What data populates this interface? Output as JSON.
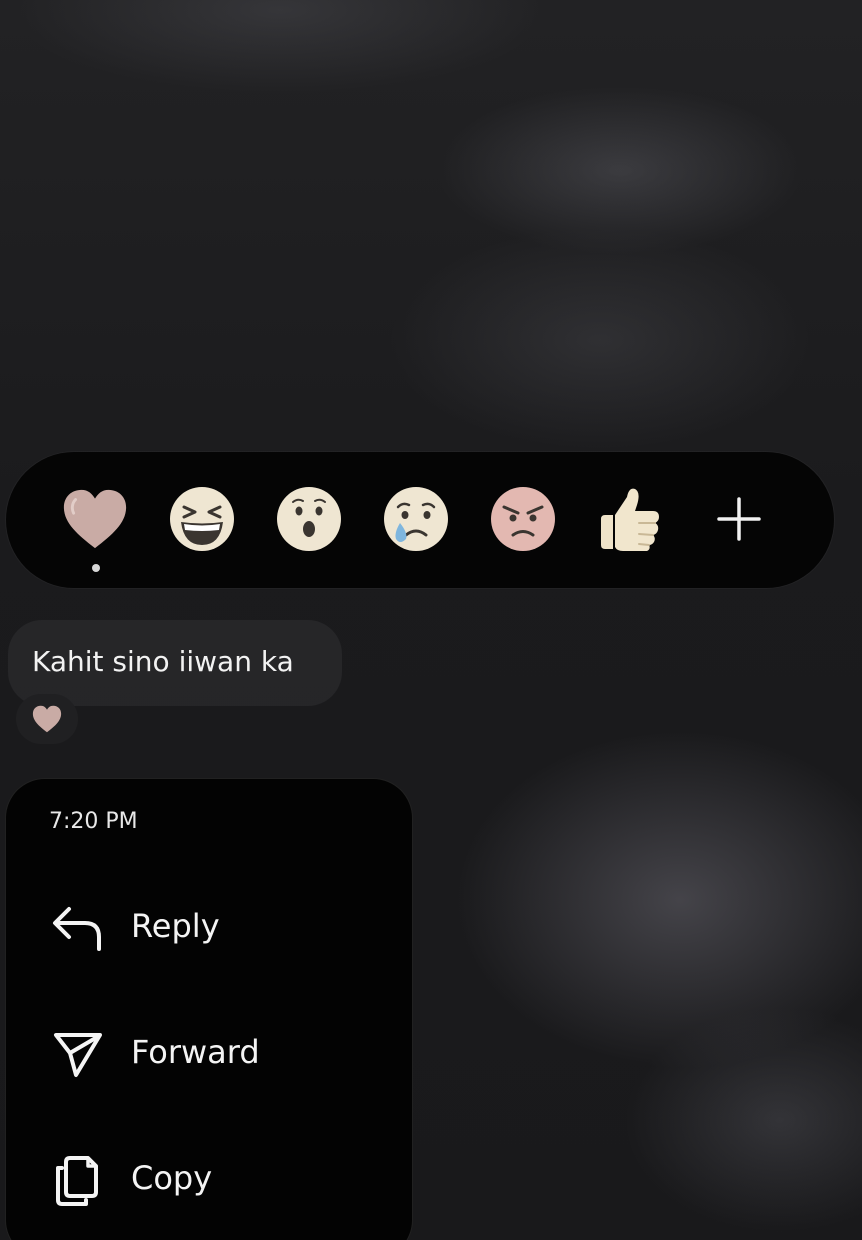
{
  "reactions": [
    {
      "name": "heart",
      "selected": true
    },
    {
      "name": "laughing"
    },
    {
      "name": "surprised"
    },
    {
      "name": "crying"
    },
    {
      "name": "angry"
    },
    {
      "name": "thumbs-up"
    },
    {
      "name": "plus"
    }
  ],
  "message": {
    "text": "Kahit sino iiwan ka",
    "reaction": "heart"
  },
  "menu": {
    "time": "7:20 PM",
    "items": [
      {
        "label": "Reply",
        "icon": "reply-icon"
      },
      {
        "label": "Forward",
        "icon": "forward-icon"
      },
      {
        "label": "Copy",
        "icon": "copy-icon"
      }
    ]
  },
  "colors": {
    "heart": "#c8a9a4",
    "emoji_face": "#efe6d2",
    "angry_face": "#e2b7b0",
    "menu_background": "#030303",
    "reaction_bar_background": "#050505",
    "text": "#f4f4f4"
  }
}
